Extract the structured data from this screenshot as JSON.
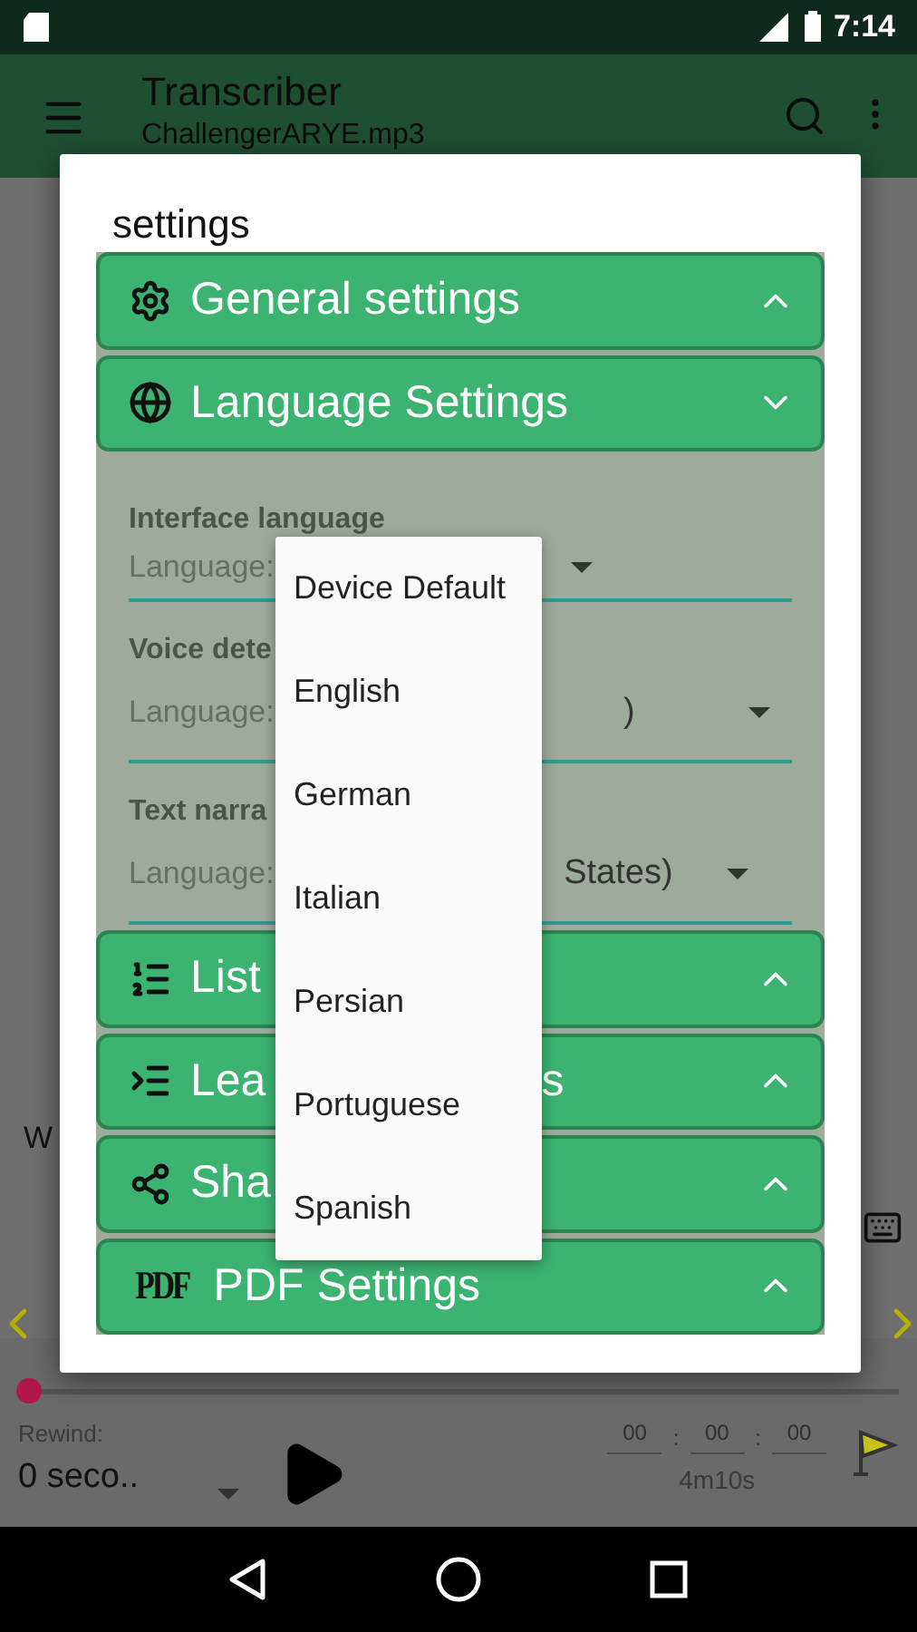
{
  "status_bar": {
    "time": "7:14"
  },
  "app_bar": {
    "title": "Transcriber",
    "subtitle": "ChallengerARYE.mp3"
  },
  "background": {
    "stray_text": "W"
  },
  "player": {
    "progress": {
      "level": 0
    },
    "rewind_label": "Rewind:",
    "rewind_value": "0 seco..",
    "time_fields": [
      "00",
      "00",
      "00"
    ],
    "time_separators": [
      ":",
      ":"
    ],
    "duration": "4m10s"
  },
  "dialog": {
    "title": "settings",
    "sections": [
      {
        "kind": "gear",
        "title": "General settings",
        "expanded": false
      },
      {
        "kind": "globe",
        "title": "Language Settings",
        "expanded": true
      },
      {
        "kind": "list",
        "title": "List",
        "expanded": false
      },
      {
        "kind": "indent",
        "title": "Lea",
        "title_end": "s",
        "expanded": false
      },
      {
        "kind": "share",
        "title": "Sha",
        "expanded": false
      },
      {
        "kind": "pdf",
        "icon_text": "PDF",
        "title": "PDF Settings",
        "expanded": false
      }
    ],
    "language_fields": [
      {
        "label": "Interface language",
        "prefix": "Language:"
      },
      {
        "label": "Voice dete",
        "prefix": "Language:",
        "value": ")"
      },
      {
        "label": "Text narra",
        "prefix": "Language:",
        "value": "States)"
      }
    ]
  },
  "menu": {
    "items": [
      "Device Default",
      "English",
      "German",
      "Italian",
      "Persian",
      "Portuguese",
      "Spanish"
    ]
  }
}
